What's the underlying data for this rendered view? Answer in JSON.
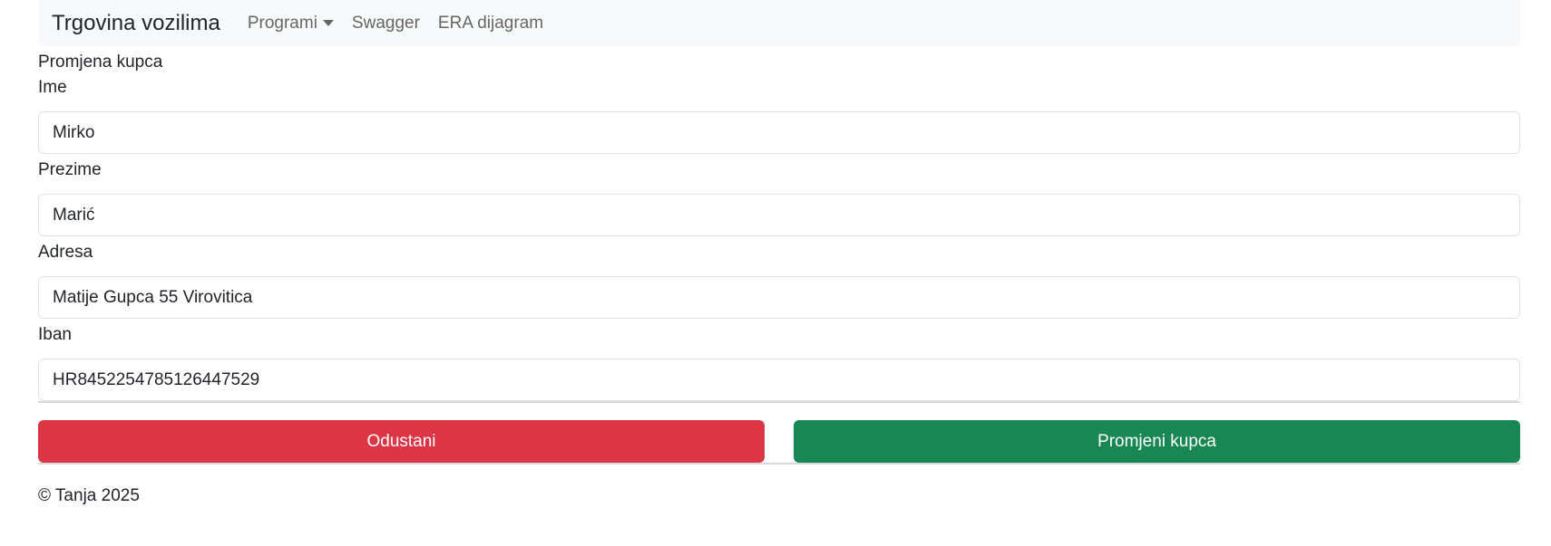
{
  "navbar": {
    "brand": "Trgovina vozilima",
    "items": [
      {
        "label": "Programi",
        "dropdown": true
      },
      {
        "label": "Swagger"
      },
      {
        "label": "ERA dijagram"
      }
    ]
  },
  "form": {
    "title": "Promjena kupca",
    "fields": [
      {
        "label": "Ime",
        "value": "Mirko"
      },
      {
        "label": "Prezime",
        "value": "Marić"
      },
      {
        "label": "Adresa",
        "value": "Matije Gupca 55 Virovitica"
      },
      {
        "label": "Iban",
        "value": "HR8452254785126447529"
      }
    ],
    "cancel_label": "Odustani",
    "submit_label": "Promjeni kupca"
  },
  "footer": {
    "text": "© Tanja 2025"
  },
  "colors": {
    "navbar_bg": "#f8f9fa",
    "danger": "#dc3545",
    "success": "#198754"
  }
}
